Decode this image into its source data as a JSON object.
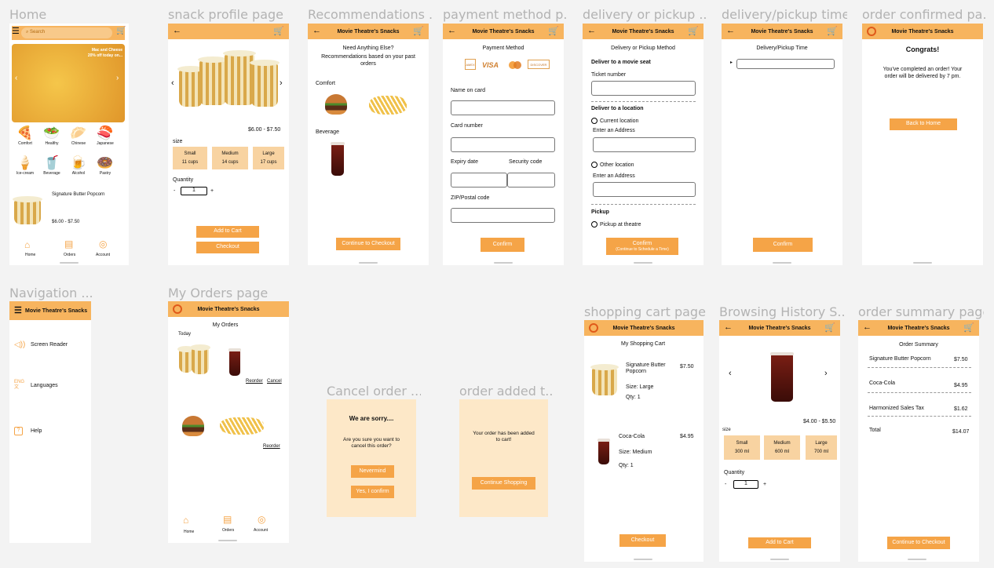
{
  "frames": {
    "home": "Home",
    "snack_profile": "snack profile page",
    "recommendations": "Recommendations ...",
    "payment": "payment method p...",
    "delivery": "delivery or pickup ...",
    "delivery_time": "delivery/pickup time",
    "order_confirmed": "order confirmed pa...",
    "navigation": "Navigation ...",
    "my_orders": "My Orders page",
    "cancel_order": "Cancel order ...",
    "order_added": "order added t...",
    "shopping_cart": "shopping cart page",
    "browsing_history": "Browsing History S...",
    "order_summary": "order summary page"
  },
  "app_title": "Movie Theatre's Snacks",
  "home": {
    "search_placeholder": "Search",
    "banner_line1": "Mac and Cheese",
    "banner_line2": "20% off today on...",
    "categories": [
      "Comfort",
      "Healthy",
      "Chinese",
      "Japanese",
      "Ice-cream",
      "Beverage",
      "Alcohol",
      "Pastry"
    ],
    "featured_name": "Signature Butter Popcorn",
    "featured_price": "$6.00 - $7.50",
    "nav": [
      "Home",
      "Orders",
      "Account"
    ]
  },
  "snack": {
    "price": "$6.00 - $7.50",
    "size_label": "size",
    "sizes": [
      {
        "name": "Small",
        "qty": "11 cups"
      },
      {
        "name": "Medium",
        "qty": "14 cups"
      },
      {
        "name": "Large",
        "qty": "17 cups"
      }
    ],
    "quantity_label": "Quantity",
    "quantity": "1",
    "minus": "-",
    "plus": "+",
    "add_to_cart": "Add to Cart",
    "checkout": "Checkout"
  },
  "recommend": {
    "title": "Need Anything Else?",
    "subtitle": "Recommendations based on your past orders",
    "comfort": "Comfort",
    "beverage": "Beverage",
    "continue": "Continue to Checkout"
  },
  "payment": {
    "title": "Payment Method",
    "cards": [
      "AMEX",
      "VISA",
      "MC",
      "DISCOVER"
    ],
    "name_on_card": "Name on card",
    "card_number": "Card number",
    "expiry": "Expiry date",
    "security": "Security code",
    "zip": "ZIP/Postal code",
    "confirm": "Confirm"
  },
  "delivery": {
    "title": "Delivery or Pickup Method",
    "seat_heading": "Deliver to a movie seat",
    "ticket": "Ticket number",
    "location_heading": "Deliver to a location",
    "current": "Current location",
    "address1": "Enter an Address",
    "other": "Other location",
    "address2": "Enter an Address",
    "pickup_heading": "Pickup",
    "pickup_option": "Pickup at theatre",
    "confirm": "Confirm",
    "confirm_sub": "(Continue to Schedule a Time)"
  },
  "time": {
    "title": "Delivery/Pickup Time",
    "confirm": "Confirm"
  },
  "confirmed": {
    "title": "Congrats!",
    "message": "You've completed an order! Your order will be delivered by 7 pm.",
    "back": "Back to Home"
  },
  "navigation": {
    "items": [
      "Screen Reader",
      "Languages",
      "Help"
    ],
    "lang_badge": "ENG"
  },
  "orders": {
    "title": "My Orders",
    "today": "Today",
    "reorder": "Reorder",
    "cancel": "Cancel",
    "reorder2": "Reorder",
    "nav": [
      "Home",
      "Orders",
      "Account"
    ]
  },
  "cancel": {
    "title": "We are sorry....",
    "message": "Are you sure you want to cancel this order?",
    "nevermind": "Nevermind",
    "confirm": "Yes, I confirm"
  },
  "added": {
    "message": "Your order has been added to cart!",
    "continue": "Continue Shopping"
  },
  "cart": {
    "title": "My Shopping Cart",
    "item1_name": "Signature Butter Popcorn",
    "item1_price": "$7.50",
    "item1_size": "Size: Large",
    "item1_qty": "Qty: 1",
    "item2_name": "Coca-Cola",
    "item2_price": "$4.95",
    "item2_size": "Size: Medium",
    "item2_qty": "Qty: 1",
    "checkout": "Checkout"
  },
  "history": {
    "price": "$4.00 - $5.50",
    "size_label": "size",
    "sizes": [
      {
        "name": "Small",
        "qty": "300 ml"
      },
      {
        "name": "Medium",
        "qty": "600 ml"
      },
      {
        "name": "Large",
        "qty": "700 ml"
      }
    ],
    "quantity_label": "Quantity",
    "quantity": "1",
    "minus": "-",
    "plus": "+",
    "add_to_cart": "Add to Cart"
  },
  "summary": {
    "title": "Order Summary",
    "lines": [
      {
        "name": "Signature Butter Popcorn",
        "price": "$7.50"
      },
      {
        "name": "Coca-Cola",
        "price": "$4.95"
      },
      {
        "name": "Harmonized Sales Tax",
        "price": "$1.62"
      },
      {
        "name": "Total",
        "price": "$14.07"
      }
    ],
    "continue": "Continue to Checkout"
  },
  "colors": {
    "accent": "#f7b45e",
    "button": "#f5a447",
    "size_box": "#f8d3a1",
    "overlay": "#fde8c8"
  }
}
